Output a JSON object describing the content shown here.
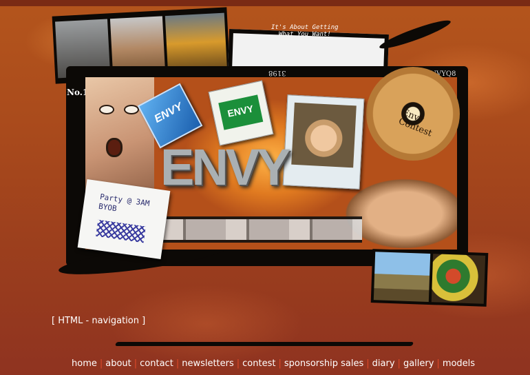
{
  "header": {
    "tagline_line1": "It's About Getting",
    "tagline_line2": "What You Want!",
    "label_no": "No.1",
    "label_number": "3198",
    "label_envy_q": "ENVYQ8"
  },
  "collage": {
    "envy_title": "ENVY",
    "card_blue": "ENVY",
    "card_pack": "ENVY",
    "cd_label": "Envy\nContest",
    "note_line1": "Party @ 3AM",
    "note_line2": "BYOB",
    "note_scribble": "ENVY"
  },
  "html_navigation": "[ HTML - navigation ]",
  "nav": {
    "items": [
      "home",
      "about",
      "contact",
      "newsletters",
      "contest",
      "sponsorship sales",
      "diary",
      "gallery",
      "models"
    ]
  },
  "colors": {
    "background": "#a94a1c",
    "nav_separator": "#e04a2a",
    "text": "#ffffff"
  }
}
